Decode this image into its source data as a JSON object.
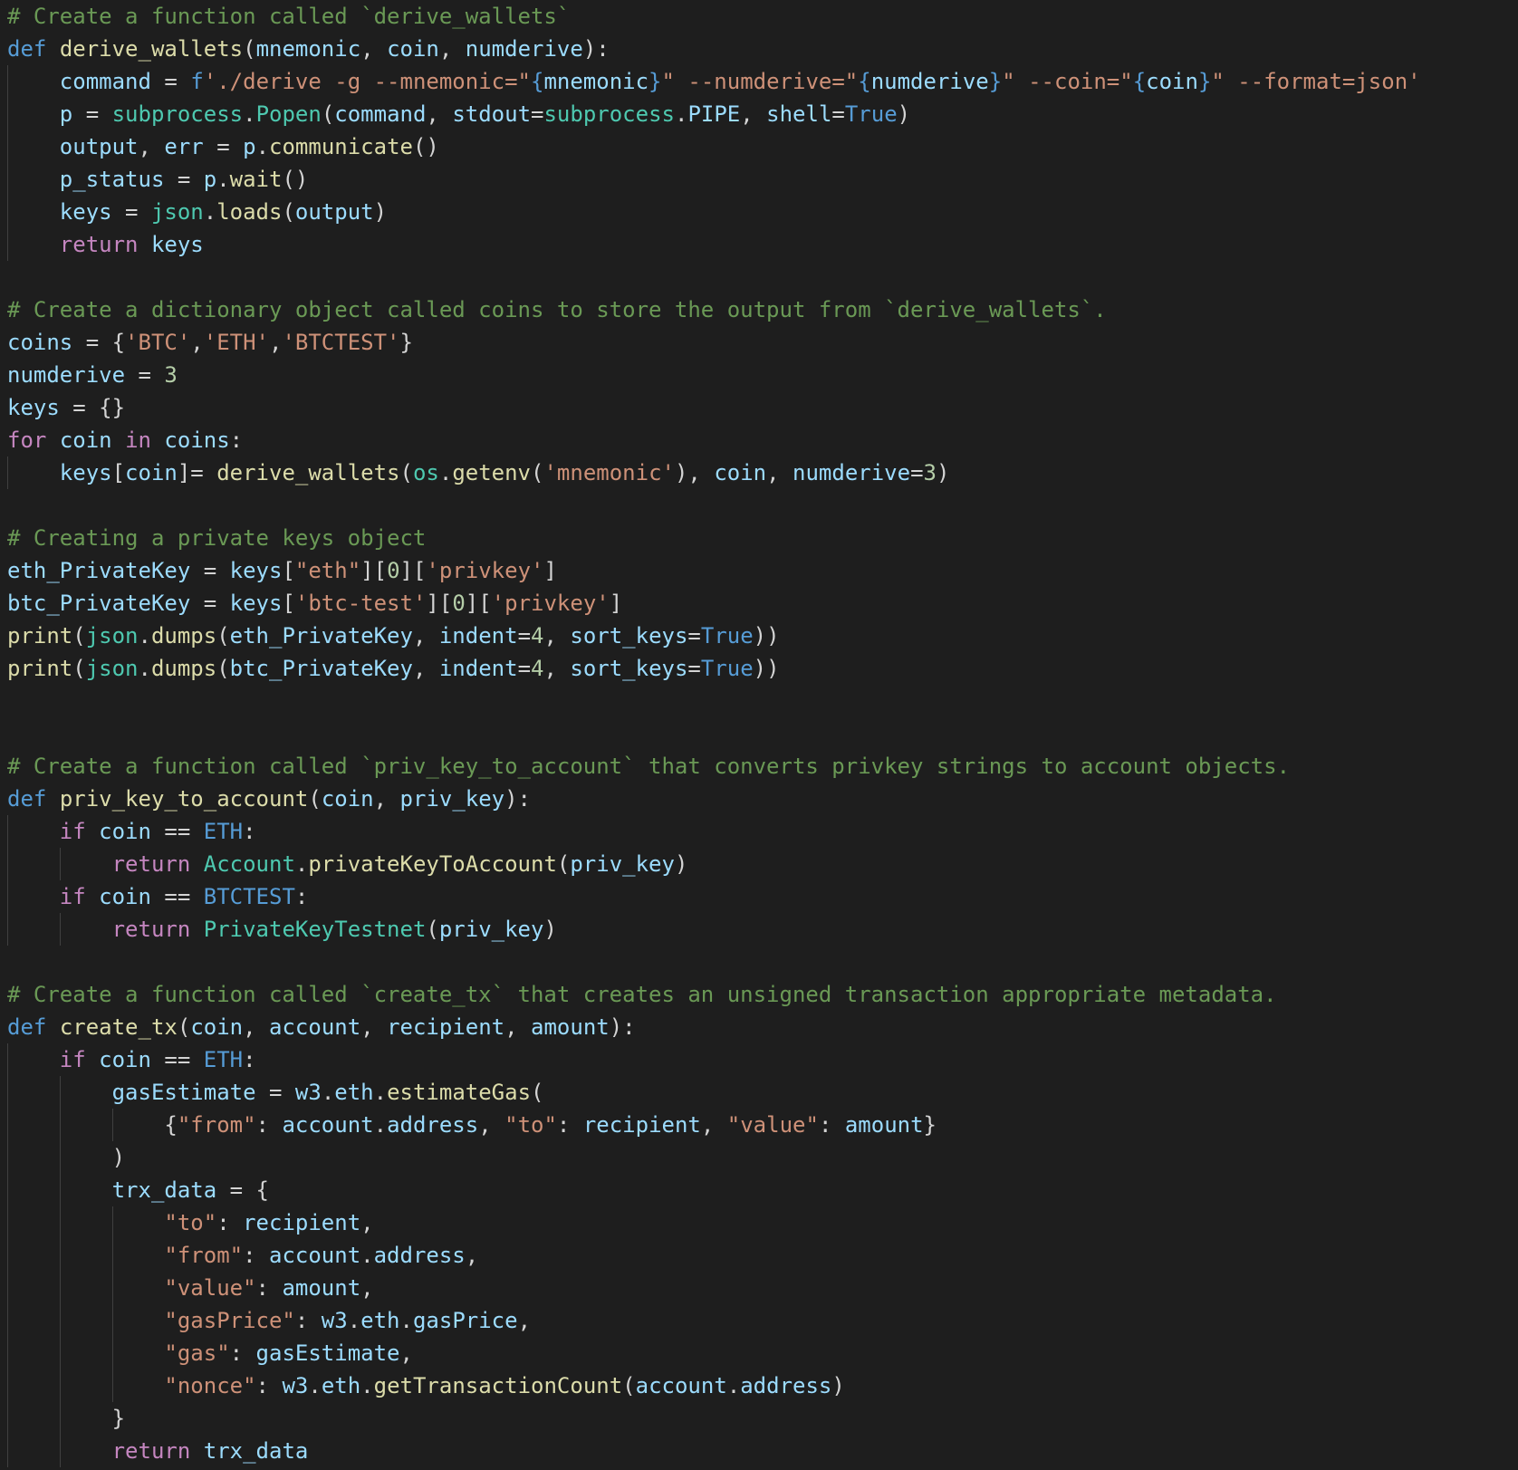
{
  "editor": {
    "language": "python",
    "theme_colors": {
      "background": "#1e1e1e",
      "comment": "#6a9955",
      "keyword_def": "#569cd6",
      "keyword_control": "#c586c0",
      "function": "#dcdcaa",
      "variable": "#9cdcfe",
      "string": "#ce9178",
      "number": "#b5cea8",
      "type": "#4ec9b0",
      "plain": "#d4d4d4"
    },
    "lines": [
      [
        [
          "c",
          "# Create a function called `derive_wallets`"
        ]
      ],
      [
        [
          "k",
          "def"
        ],
        [
          "o",
          " "
        ],
        [
          "f",
          "derive_wallets"
        ],
        [
          "o",
          "("
        ],
        [
          "p",
          "mnemonic"
        ],
        [
          "o",
          ", "
        ],
        [
          "p",
          "coin"
        ],
        [
          "o",
          ", "
        ],
        [
          "p",
          "numderive"
        ],
        [
          "o",
          "):"
        ]
      ],
      [
        [
          "o",
          "    "
        ],
        [
          "p",
          "command"
        ],
        [
          "o",
          " = "
        ],
        [
          "k",
          "f"
        ],
        [
          "s",
          "'./derive -g --mnemonic=\""
        ],
        [
          "b",
          "{"
        ],
        [
          "p",
          "mnemonic"
        ],
        [
          "b",
          "}"
        ],
        [
          "s",
          "\" --numderive=\""
        ],
        [
          "b",
          "{"
        ],
        [
          "p",
          "numderive"
        ],
        [
          "b",
          "}"
        ],
        [
          "s",
          "\" --coin=\""
        ],
        [
          "b",
          "{"
        ],
        [
          "p",
          "coin"
        ],
        [
          "b",
          "}"
        ],
        [
          "s",
          "\" --format=json'"
        ]
      ],
      [
        [
          "o",
          "    "
        ],
        [
          "p",
          "p"
        ],
        [
          "o",
          " = "
        ],
        [
          "t",
          "subprocess"
        ],
        [
          "o",
          "."
        ],
        [
          "t",
          "Popen"
        ],
        [
          "o",
          "("
        ],
        [
          "p",
          "command"
        ],
        [
          "o",
          ", "
        ],
        [
          "p",
          "stdout"
        ],
        [
          "o",
          "="
        ],
        [
          "t",
          "subprocess"
        ],
        [
          "o",
          "."
        ],
        [
          "p",
          "PIPE"
        ],
        [
          "o",
          ", "
        ],
        [
          "p",
          "shell"
        ],
        [
          "o",
          "="
        ],
        [
          "k",
          "True"
        ],
        [
          "o",
          ")"
        ]
      ],
      [
        [
          "o",
          "    "
        ],
        [
          "p",
          "output"
        ],
        [
          "o",
          ", "
        ],
        [
          "p",
          "err"
        ],
        [
          "o",
          " = "
        ],
        [
          "p",
          "p"
        ],
        [
          "o",
          "."
        ],
        [
          "f",
          "communicate"
        ],
        [
          "o",
          "()"
        ]
      ],
      [
        [
          "o",
          "    "
        ],
        [
          "p",
          "p_status"
        ],
        [
          "o",
          " = "
        ],
        [
          "p",
          "p"
        ],
        [
          "o",
          "."
        ],
        [
          "f",
          "wait"
        ],
        [
          "o",
          "()"
        ]
      ],
      [
        [
          "o",
          "    "
        ],
        [
          "p",
          "keys"
        ],
        [
          "o",
          " = "
        ],
        [
          "t",
          "json"
        ],
        [
          "o",
          "."
        ],
        [
          "f",
          "loads"
        ],
        [
          "o",
          "("
        ],
        [
          "p",
          "output"
        ],
        [
          "o",
          ")"
        ]
      ],
      [
        [
          "o",
          "    "
        ],
        [
          "kc",
          "return"
        ],
        [
          "o",
          " "
        ],
        [
          "p",
          "keys"
        ]
      ],
      [],
      [
        [
          "c",
          "# Create a dictionary object called coins to store the output from `derive_wallets`."
        ]
      ],
      [
        [
          "p",
          "coins"
        ],
        [
          "o",
          " = {"
        ],
        [
          "s",
          "'BTC'"
        ],
        [
          "o",
          ","
        ],
        [
          "s",
          "'ETH'"
        ],
        [
          "o",
          ","
        ],
        [
          "s",
          "'BTCTEST'"
        ],
        [
          "o",
          "}"
        ]
      ],
      [
        [
          "p",
          "numderive"
        ],
        [
          "o",
          " = "
        ],
        [
          "n",
          "3"
        ]
      ],
      [
        [
          "p",
          "keys"
        ],
        [
          "o",
          " = {}"
        ]
      ],
      [
        [
          "kc",
          "for"
        ],
        [
          "o",
          " "
        ],
        [
          "p",
          "coin"
        ],
        [
          "o",
          " "
        ],
        [
          "kc",
          "in"
        ],
        [
          "o",
          " "
        ],
        [
          "p",
          "coins"
        ],
        [
          "o",
          ":"
        ]
      ],
      [
        [
          "o",
          "    "
        ],
        [
          "p",
          "keys"
        ],
        [
          "o",
          "["
        ],
        [
          "p",
          "coin"
        ],
        [
          "o",
          "]= "
        ],
        [
          "f",
          "derive_wallets"
        ],
        [
          "o",
          "("
        ],
        [
          "t",
          "os"
        ],
        [
          "o",
          "."
        ],
        [
          "f",
          "getenv"
        ],
        [
          "o",
          "("
        ],
        [
          "s",
          "'mnemonic'"
        ],
        [
          "o",
          "), "
        ],
        [
          "p",
          "coin"
        ],
        [
          "o",
          ", "
        ],
        [
          "p",
          "numderive"
        ],
        [
          "o",
          "="
        ],
        [
          "n",
          "3"
        ],
        [
          "o",
          ")"
        ]
      ],
      [],
      [
        [
          "c",
          "# Creating a private keys object"
        ]
      ],
      [
        [
          "p",
          "eth_PrivateKey"
        ],
        [
          "o",
          " = "
        ],
        [
          "p",
          "keys"
        ],
        [
          "o",
          "["
        ],
        [
          "s",
          "\"eth\""
        ],
        [
          "o",
          "]["
        ],
        [
          "n",
          "0"
        ],
        [
          "o",
          "]["
        ],
        [
          "s",
          "'privkey'"
        ],
        [
          "o",
          "]"
        ]
      ],
      [
        [
          "p",
          "btc_PrivateKey"
        ],
        [
          "o",
          " = "
        ],
        [
          "p",
          "keys"
        ],
        [
          "o",
          "["
        ],
        [
          "s",
          "'btc-test'"
        ],
        [
          "o",
          "]["
        ],
        [
          "n",
          "0"
        ],
        [
          "o",
          "]["
        ],
        [
          "s",
          "'privkey'"
        ],
        [
          "o",
          "]"
        ]
      ],
      [
        [
          "f",
          "print"
        ],
        [
          "o",
          "("
        ],
        [
          "t",
          "json"
        ],
        [
          "o",
          "."
        ],
        [
          "f",
          "dumps"
        ],
        [
          "o",
          "("
        ],
        [
          "p",
          "eth_PrivateKey"
        ],
        [
          "o",
          ", "
        ],
        [
          "p",
          "indent"
        ],
        [
          "o",
          "="
        ],
        [
          "n",
          "4"
        ],
        [
          "o",
          ", "
        ],
        [
          "p",
          "sort_keys"
        ],
        [
          "o",
          "="
        ],
        [
          "k",
          "True"
        ],
        [
          "o",
          "))"
        ]
      ],
      [
        [
          "f",
          "print"
        ],
        [
          "o",
          "("
        ],
        [
          "t",
          "json"
        ],
        [
          "o",
          "."
        ],
        [
          "f",
          "dumps"
        ],
        [
          "o",
          "("
        ],
        [
          "p",
          "btc_PrivateKey"
        ],
        [
          "o",
          ", "
        ],
        [
          "p",
          "indent"
        ],
        [
          "o",
          "="
        ],
        [
          "n",
          "4"
        ],
        [
          "o",
          ", "
        ],
        [
          "p",
          "sort_keys"
        ],
        [
          "o",
          "="
        ],
        [
          "k",
          "True"
        ],
        [
          "o",
          "))"
        ]
      ],
      [],
      [],
      [
        [
          "c",
          "# Create a function called `priv_key_to_account` that converts privkey strings to account objects."
        ]
      ],
      [
        [
          "k",
          "def"
        ],
        [
          "o",
          " "
        ],
        [
          "f",
          "priv_key_to_account"
        ],
        [
          "o",
          "("
        ],
        [
          "p",
          "coin"
        ],
        [
          "o",
          ", "
        ],
        [
          "p",
          "priv_key"
        ],
        [
          "o",
          "):"
        ]
      ],
      [
        [
          "o",
          "    "
        ],
        [
          "kc",
          "if"
        ],
        [
          "o",
          " "
        ],
        [
          "p",
          "coin"
        ],
        [
          "o",
          " == "
        ],
        [
          "k",
          "ETH"
        ],
        [
          "o",
          ":"
        ]
      ],
      [
        [
          "o",
          "        "
        ],
        [
          "kc",
          "return"
        ],
        [
          "o",
          " "
        ],
        [
          "t",
          "Account"
        ],
        [
          "o",
          "."
        ],
        [
          "f",
          "privateKeyToAccount"
        ],
        [
          "o",
          "("
        ],
        [
          "p",
          "priv_key"
        ],
        [
          "o",
          ")"
        ]
      ],
      [
        [
          "o",
          "    "
        ],
        [
          "kc",
          "if"
        ],
        [
          "o",
          " "
        ],
        [
          "p",
          "coin"
        ],
        [
          "o",
          " == "
        ],
        [
          "k",
          "BTCTEST"
        ],
        [
          "o",
          ":"
        ]
      ],
      [
        [
          "o",
          "        "
        ],
        [
          "kc",
          "return"
        ],
        [
          "o",
          " "
        ],
        [
          "t",
          "PrivateKeyTestnet"
        ],
        [
          "o",
          "("
        ],
        [
          "p",
          "priv_key"
        ],
        [
          "o",
          ")"
        ]
      ],
      [],
      [
        [
          "c",
          "# Create a function called `create_tx` that creates an unsigned transaction appropriate metadata."
        ]
      ],
      [
        [
          "k",
          "def"
        ],
        [
          "o",
          " "
        ],
        [
          "f",
          "create_tx"
        ],
        [
          "o",
          "("
        ],
        [
          "p",
          "coin"
        ],
        [
          "o",
          ", "
        ],
        [
          "p",
          "account"
        ],
        [
          "o",
          ", "
        ],
        [
          "p",
          "recipient"
        ],
        [
          "o",
          ", "
        ],
        [
          "p",
          "amount"
        ],
        [
          "o",
          "):"
        ]
      ],
      [
        [
          "o",
          "    "
        ],
        [
          "kc",
          "if"
        ],
        [
          "o",
          " "
        ],
        [
          "p",
          "coin"
        ],
        [
          "o",
          " == "
        ],
        [
          "k",
          "ETH"
        ],
        [
          "o",
          ":"
        ]
      ],
      [
        [
          "o",
          "        "
        ],
        [
          "p",
          "gasEstimate"
        ],
        [
          "o",
          " = "
        ],
        [
          "p",
          "w3"
        ],
        [
          "o",
          "."
        ],
        [
          "p",
          "eth"
        ],
        [
          "o",
          "."
        ],
        [
          "f",
          "estimateGas"
        ],
        [
          "o",
          "("
        ]
      ],
      [
        [
          "o",
          "            {"
        ],
        [
          "s",
          "\"from\""
        ],
        [
          "o",
          ": "
        ],
        [
          "p",
          "account"
        ],
        [
          "o",
          "."
        ],
        [
          "p",
          "address"
        ],
        [
          "o",
          ", "
        ],
        [
          "s",
          "\"to\""
        ],
        [
          "o",
          ": "
        ],
        [
          "p",
          "recipient"
        ],
        [
          "o",
          ", "
        ],
        [
          "s",
          "\"value\""
        ],
        [
          "o",
          ": "
        ],
        [
          "p",
          "amount"
        ],
        [
          "o",
          "}"
        ]
      ],
      [
        [
          "o",
          "        )"
        ]
      ],
      [
        [
          "o",
          "        "
        ],
        [
          "p",
          "trx_data"
        ],
        [
          "o",
          " = {"
        ]
      ],
      [
        [
          "o",
          "            "
        ],
        [
          "s",
          "\"to\""
        ],
        [
          "o",
          ": "
        ],
        [
          "p",
          "recipient"
        ],
        [
          "o",
          ","
        ]
      ],
      [
        [
          "o",
          "            "
        ],
        [
          "s",
          "\"from\""
        ],
        [
          "o",
          ": "
        ],
        [
          "p",
          "account"
        ],
        [
          "o",
          "."
        ],
        [
          "p",
          "address"
        ],
        [
          "o",
          ","
        ]
      ],
      [
        [
          "o",
          "            "
        ],
        [
          "s",
          "\"value\""
        ],
        [
          "o",
          ": "
        ],
        [
          "p",
          "amount"
        ],
        [
          "o",
          ","
        ]
      ],
      [
        [
          "o",
          "            "
        ],
        [
          "s",
          "\"gasPrice\""
        ],
        [
          "o",
          ": "
        ],
        [
          "p",
          "w3"
        ],
        [
          "o",
          "."
        ],
        [
          "p",
          "eth"
        ],
        [
          "o",
          "."
        ],
        [
          "p",
          "gasPrice"
        ],
        [
          "o",
          ","
        ]
      ],
      [
        [
          "o",
          "            "
        ],
        [
          "s",
          "\"gas\""
        ],
        [
          "o",
          ": "
        ],
        [
          "p",
          "gasEstimate"
        ],
        [
          "o",
          ","
        ]
      ],
      [
        [
          "o",
          "            "
        ],
        [
          "s",
          "\"nonce\""
        ],
        [
          "o",
          ": "
        ],
        [
          "p",
          "w3"
        ],
        [
          "o",
          "."
        ],
        [
          "p",
          "eth"
        ],
        [
          "o",
          "."
        ],
        [
          "f",
          "getTransactionCount"
        ],
        [
          "o",
          "("
        ],
        [
          "p",
          "account"
        ],
        [
          "o",
          "."
        ],
        [
          "p",
          "address"
        ],
        [
          "o",
          ")"
        ]
      ],
      [
        [
          "o",
          "        }"
        ]
      ],
      [
        [
          "o",
          "        "
        ],
        [
          "kc",
          "return"
        ],
        [
          "o",
          " "
        ],
        [
          "p",
          "trx_data"
        ]
      ]
    ],
    "cursor_line": 45
  }
}
